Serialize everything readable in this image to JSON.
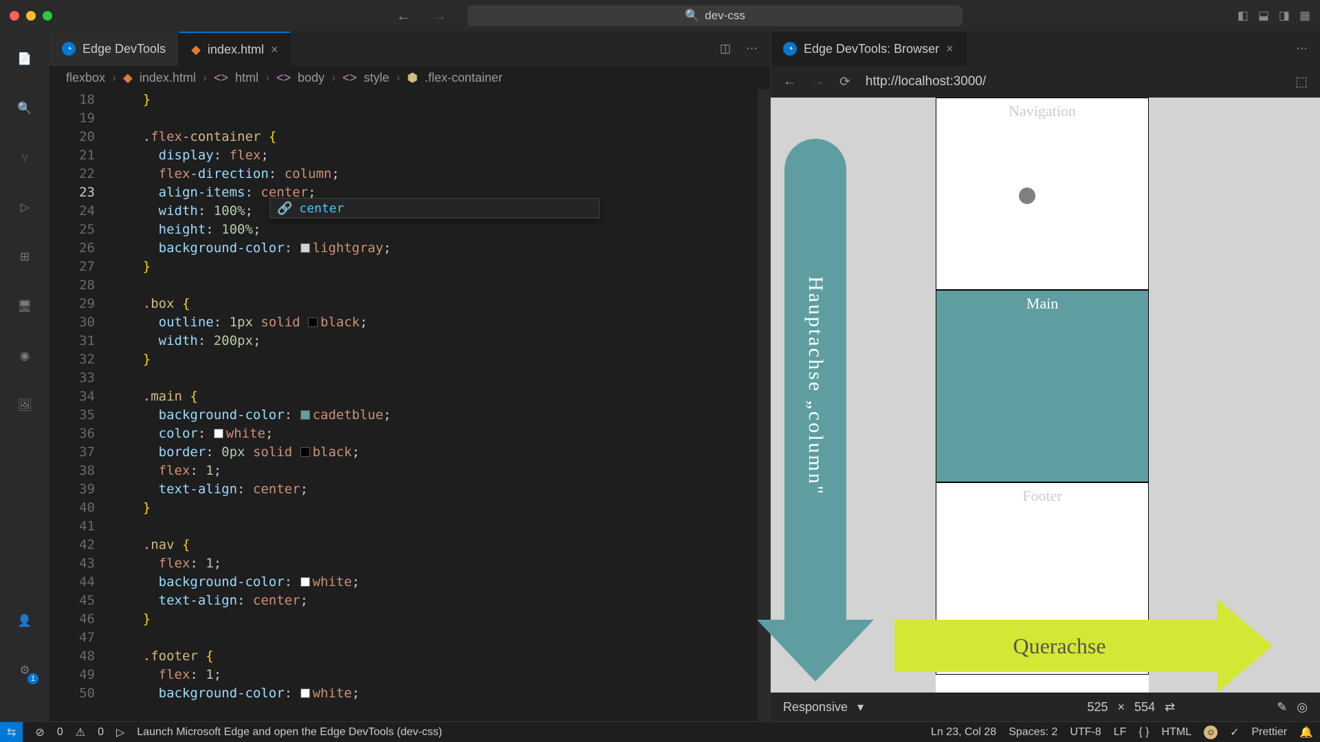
{
  "titlebar": {
    "project": "dev-css"
  },
  "nav": {
    "back": "←",
    "forward": "→"
  },
  "tabs": [
    {
      "label": "Edge DevTools",
      "active": false,
      "closable": false
    },
    {
      "label": "index.html",
      "active": true,
      "closable": true
    }
  ],
  "right_tab": {
    "label": "Edge DevTools: Browser",
    "closable": true
  },
  "breadcrumb": [
    "flexbox",
    "index.html",
    "html",
    "body",
    "style",
    ".flex-container"
  ],
  "line_start": 18,
  "current_line": 23,
  "code_lines": [
    "    }",
    "",
    "    .flex-container {",
    "      display: flex;",
    "      flex-direction: column;",
    "      align-items: center;",
    "      width: 100%;",
    "      height: 100%;",
    "      background-color: lightgray;",
    "    }",
    "",
    "    .box {",
    "      outline: 1px solid black;",
    "      width: 200px;",
    "    }",
    "",
    "    .main {",
    "      background-color: cadetblue;",
    "      color: white;",
    "      border: 0px solid black;",
    "      flex: 1;",
    "      text-align: center;",
    "    }",
    "",
    "    .nav {",
    "      flex: 1;",
    "      background-color: white;",
    "      text-align: center;",
    "    }",
    "",
    "    .footer {",
    "      flex: 1;",
    "      background-color: white;"
  ],
  "suggestion": "center",
  "browser": {
    "url": "http://localhost:3000/",
    "device": "Responsive",
    "width": "525",
    "height": "554"
  },
  "preview": {
    "vert_arrow": "Hauptachse „column\"",
    "horz_arrow": "Querachse",
    "nav": "Navigation",
    "main": "Main",
    "footer": "Footer"
  },
  "status": {
    "launch_msg": "Launch Microsoft Edge and open the Edge DevTools (dev-css)",
    "errors": "0",
    "warnings": "0",
    "cursor": "Ln 23, Col 28",
    "spaces": "Spaces: 2",
    "encoding": "UTF-8",
    "eol": "LF",
    "lang": "HTML",
    "prettier": "Prettier"
  }
}
